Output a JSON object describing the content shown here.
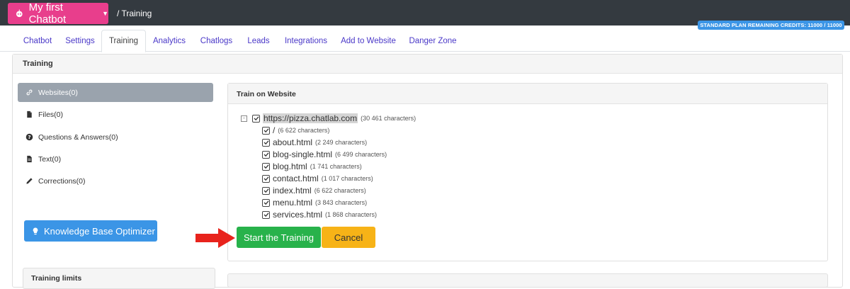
{
  "header": {
    "bot_name": "My first Chatbot",
    "breadcrumb": "/ Training",
    "credits_badge": "STANDARD PLAN REMAINING CREDITS: 11000 / 11000"
  },
  "tabs": [
    {
      "label": "Chatbot"
    },
    {
      "label": "Settings"
    },
    {
      "label": "Training"
    },
    {
      "label": "Analytics"
    },
    {
      "label": "Chatlogs"
    },
    {
      "label": "Leads"
    },
    {
      "label": "Integrations"
    },
    {
      "label": "Add to Website"
    },
    {
      "label": "Danger Zone"
    }
  ],
  "active_tab": "Training",
  "panel_title": "Training",
  "sidebar": {
    "items": [
      {
        "label": "Websites(0)",
        "icon": "link-icon"
      },
      {
        "label": "Files(0)",
        "icon": "file-icon"
      },
      {
        "label": "Questions & Answers(0)",
        "icon": "question-circle-icon"
      },
      {
        "label": "Text(0)",
        "icon": "file-text-icon"
      },
      {
        "label": "Corrections(0)",
        "icon": "pencil-icon"
      }
    ],
    "optimizer_button": "Knowledge Base Optimizer",
    "limits_title": "Training limits"
  },
  "train": {
    "title": "Train on Website",
    "root": {
      "url": "https://pizza.chatlab.com",
      "chars": "(30 461 characters)",
      "toggle": "-"
    },
    "pages": [
      {
        "name": "/",
        "chars": "(6 622 characters)"
      },
      {
        "name": "about.html",
        "chars": "(2 249 characters)"
      },
      {
        "name": "blog-single.html",
        "chars": "(6 499 characters)"
      },
      {
        "name": "blog.html",
        "chars": "(1 741 characters)"
      },
      {
        "name": "contact.html",
        "chars": "(1 017 characters)"
      },
      {
        "name": "index.html",
        "chars": "(6 622 characters)"
      },
      {
        "name": "menu.html",
        "chars": "(3 843 characters)"
      },
      {
        "name": "services.html",
        "chars": "(1 868 characters)"
      }
    ],
    "start_button": "Start the Training",
    "cancel_button": "Cancel"
  },
  "colors": {
    "topbar": "#343a40",
    "bot_button": "#e83e8c",
    "credits_badge": "#3b95e6",
    "start_button": "#28b24b",
    "cancel_button": "#f7b317",
    "arrow": "#e8231c",
    "active_sidebar": "#9aa3ad"
  }
}
